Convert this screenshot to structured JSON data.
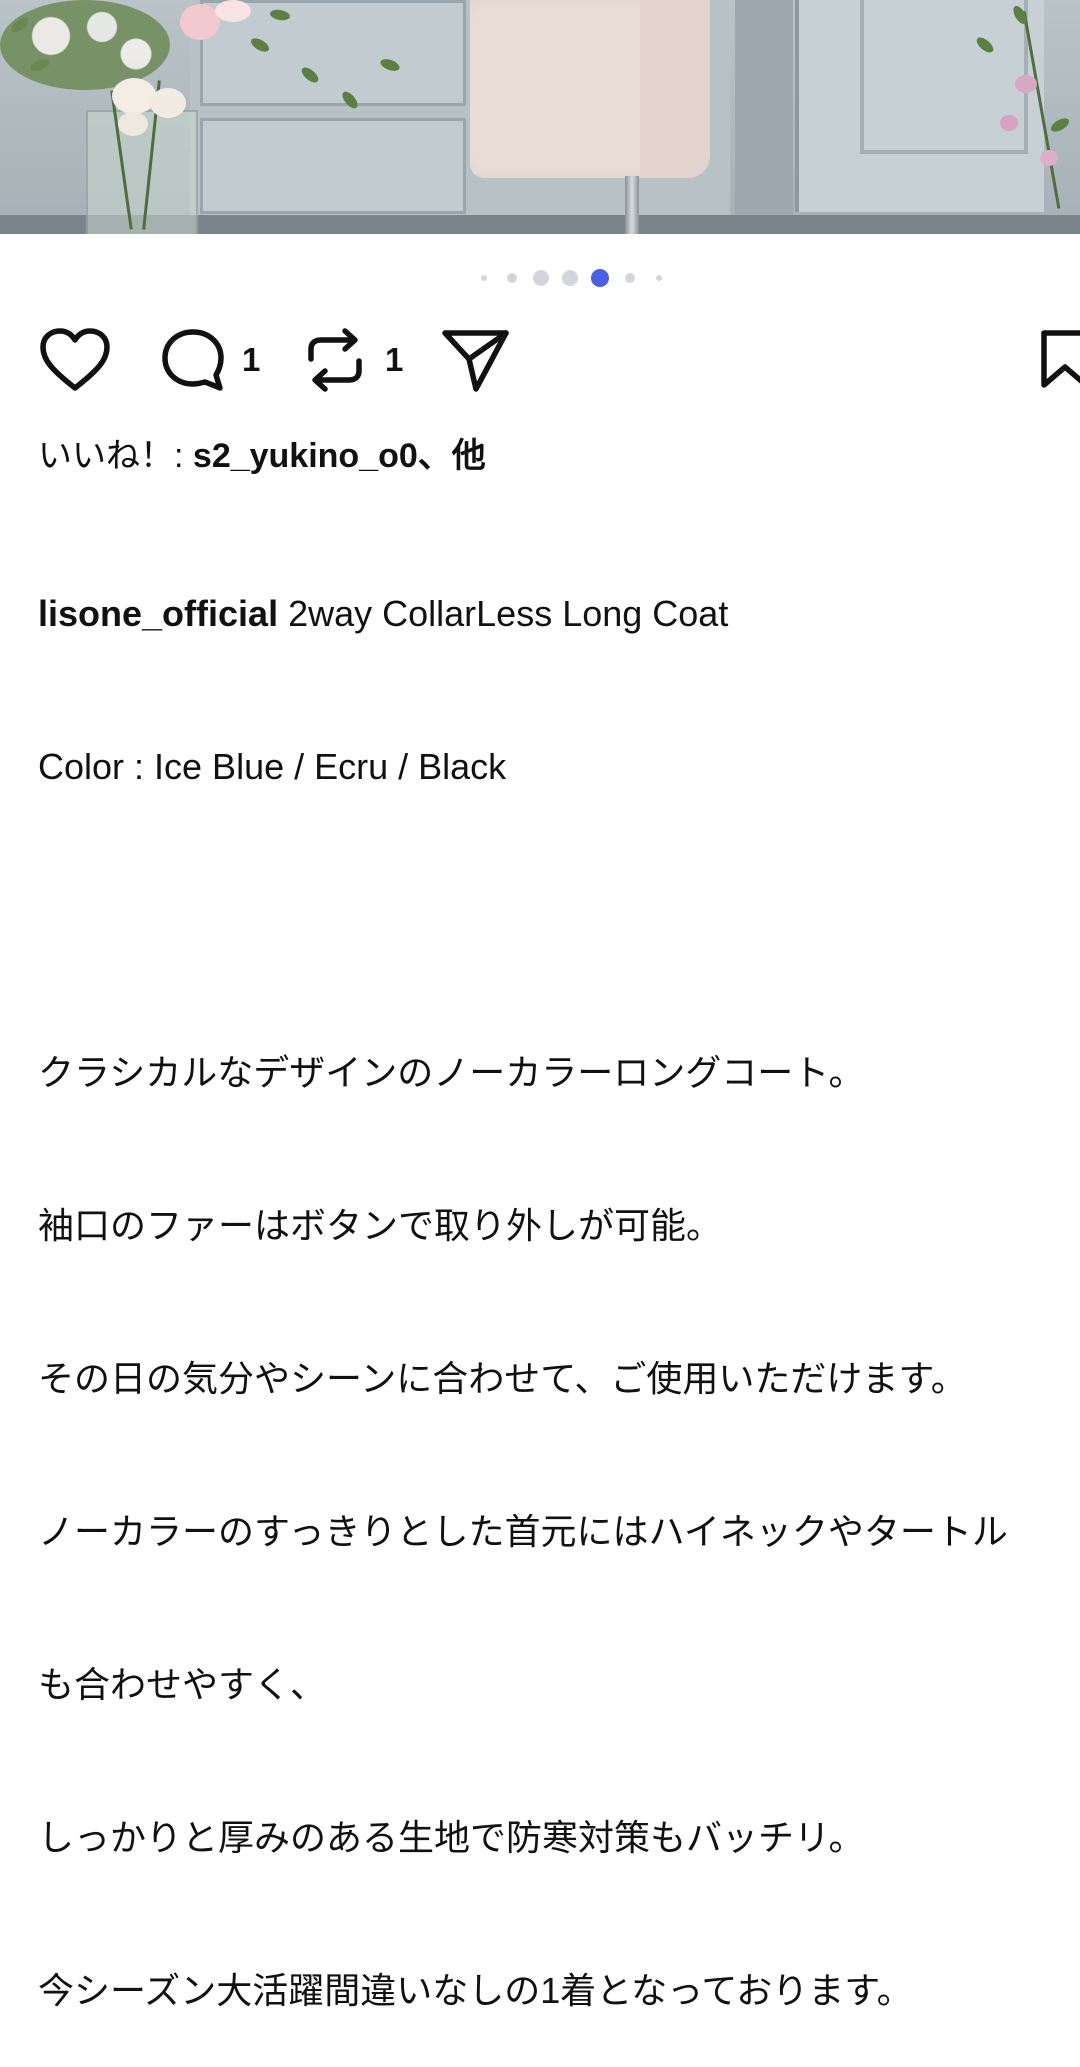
{
  "post": {
    "image_alt": "Pink collarless long coat on a mannequin beside flower arrangements",
    "carousel": {
      "total": 7,
      "active_index": 4
    },
    "actions": {
      "like_icon": "heart-icon",
      "comment_icon": "comment-icon",
      "comment_count": "1",
      "repost_icon": "repost-icon",
      "repost_count": "1",
      "share_icon": "share-icon",
      "save_icon": "bookmark-icon"
    },
    "likes": {
      "prefix": "いいね！: ",
      "user": "s2_yukino_o0",
      "suffix": "、他"
    },
    "caption": {
      "username": "lisone_official",
      "first_line_rest": " 2way CollarLess Long Coat",
      "lines": [
        "Color : Ice Blue / Ecru / Black",
        "",
        "クラシカルなデザインのノーカラーロングコート。",
        "袖口のファーはボタンで取り外しが可能。",
        "その日の気分やシーンに合わせて、ご使用いただけます。",
        "ノーカラーのすっきりとした首元にはハイネックやタートル",
        "も合わせやすく、",
        "しっかりと厚みのある生地で防寒対策もバッチリ。",
        "今シーズン大活躍間違いなしの1着となっております。"
      ]
    }
  }
}
